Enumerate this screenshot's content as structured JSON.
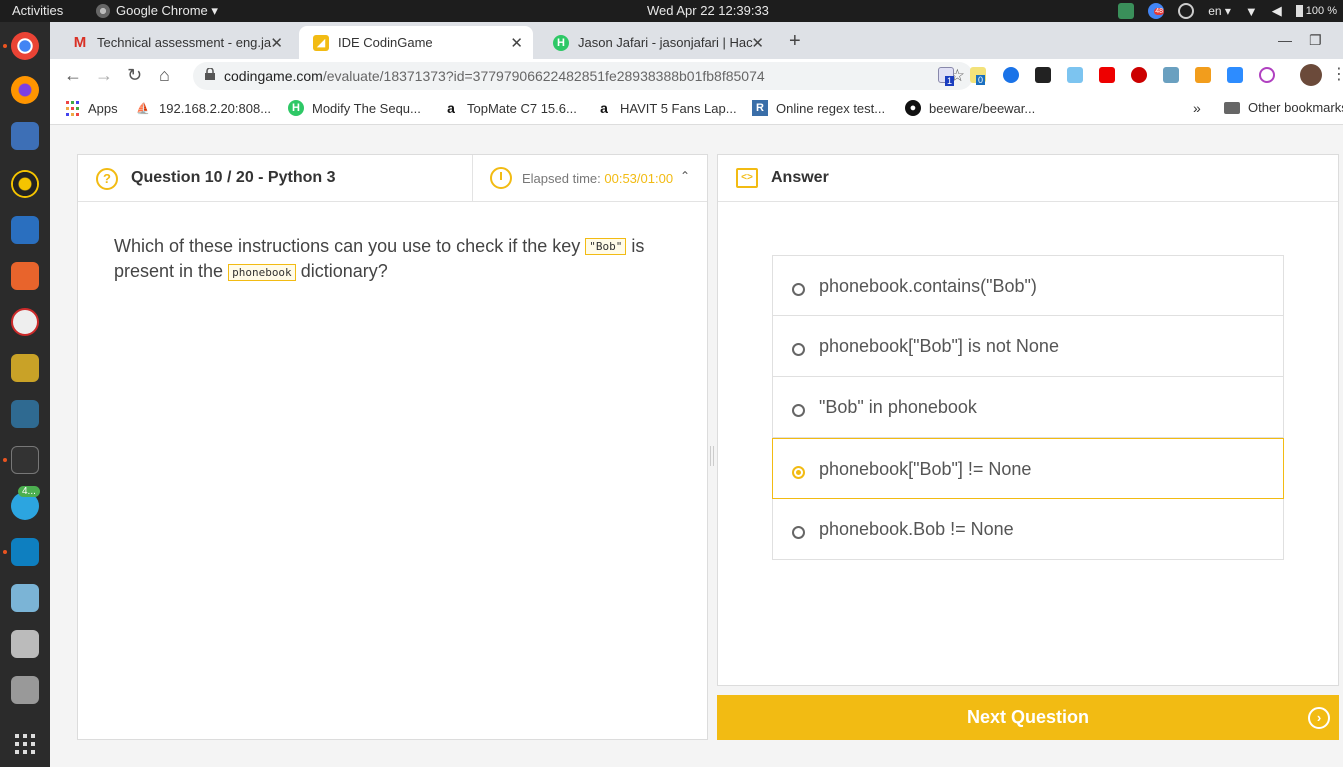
{
  "system": {
    "activities": "Activities",
    "app_name": "Google Chrome ▾",
    "clock": "Wed Apr 22  12:39:33",
    "language": "en ▾",
    "battery": "100 %",
    "notification_count": "48"
  },
  "dock": {
    "telegram_badge": "4..."
  },
  "tabs": [
    {
      "label": "Technical assessment - eng.ja",
      "favicon": "gmail-icon"
    },
    {
      "label": "IDE CodinGame",
      "favicon": "codingame-icon"
    },
    {
      "label": "Jason Jafari - jasonjafari | Hac",
      "favicon": "hackerrank-icon"
    }
  ],
  "toolbar": {
    "url_domain": "codingame.com",
    "url_path": "/evaluate/18371373?id=37797906622482851fe28938388b01fb8f85074",
    "ext_badge_1": "1",
    "ext_badge_2": "0"
  },
  "bookmarks": {
    "apps": "Apps",
    "items": [
      "192.168.2.20:808...",
      "Modify The Sequ...",
      "TopMate C7 15.6...",
      "HAVIT 5 Fans Lap...",
      "Online regex test...",
      "beeware/beewar..."
    ],
    "overflow": "»",
    "other": "Other bookmarks"
  },
  "question": {
    "title": "Question 10 / 20 - Python 3",
    "timer_label": "Elapsed time: ",
    "timer_value": "00:53/01:00",
    "text_part1": "Which of these instructions can you use to check if the key ",
    "code1": "\"Bob\"",
    "text_part2": " is present in the ",
    "code2": "phonebook",
    "text_part3": " dictionary?"
  },
  "answer": {
    "title": "Answer",
    "options": [
      "phonebook.contains(\"Bob\")",
      "phonebook[\"Bob\"] is not None",
      "\"Bob\" in phonebook",
      "phonebook[\"Bob\"] != None",
      "phonebook.Bob != None"
    ],
    "selected_index": 3
  },
  "next_button": "Next Question",
  "colors": {
    "accent": "#f2bb13",
    "dock": "#2b2b2b",
    "topbar": "#1d1d1d"
  }
}
